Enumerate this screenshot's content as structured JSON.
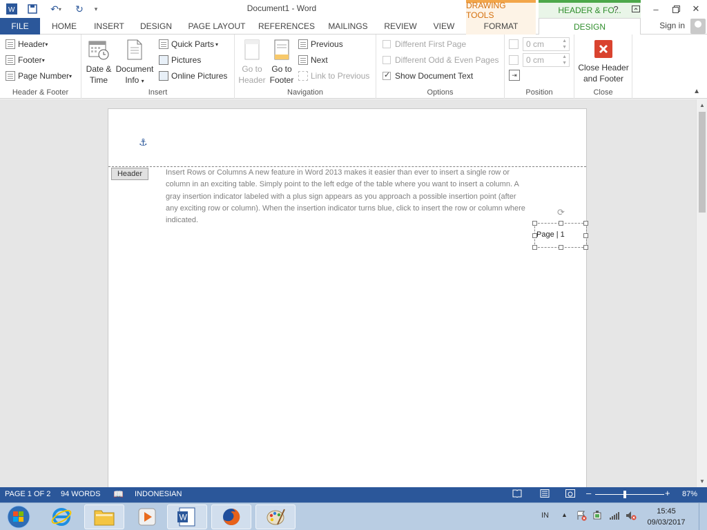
{
  "titlebar": {
    "title": "Document1 - Word",
    "context_drawing_tools": "DRAWING TOOLS",
    "context_header_footer": "HEADER & FO...",
    "help": "?",
    "colors": {
      "word_blue": "#2b579a",
      "drawing_tools": "#d5700d",
      "header_footer": "#2e8d2b"
    }
  },
  "tabs": {
    "file": "FILE",
    "home": "HOME",
    "insert": "INSERT",
    "design": "DESIGN",
    "page_layout": "PAGE LAYOUT",
    "references": "REFERENCES",
    "mailings": "MAILINGS",
    "review": "REVIEW",
    "view": "VIEW",
    "format": "FORMAT",
    "design_hf": "DESIGN",
    "sign_in": "Sign in"
  },
  "ribbon": {
    "header_footer": {
      "label": "Header & Footer",
      "header": "Header",
      "footer": "Footer",
      "page_number": "Page Number"
    },
    "insert": {
      "label": "Insert",
      "date_time_1": "Date &",
      "date_time_2": "Time",
      "doc_info_1": "Document",
      "doc_info_2": "Info",
      "quick_parts": "Quick Parts",
      "pictures": "Pictures",
      "online_pictures": "Online Pictures"
    },
    "navigation": {
      "label": "Navigation",
      "go_header_1": "Go to",
      "go_header_2": "Header",
      "go_footer_1": "Go to",
      "go_footer_2": "Footer",
      "previous": "Previous",
      "next": "Next",
      "link_previous": "Link to Previous"
    },
    "options": {
      "label": "Options",
      "different_first_page": "Different First Page",
      "different_odd_even": "Different Odd & Even Pages",
      "show_document_text": "Show Document Text",
      "show_document_text_checked": true
    },
    "position": {
      "label": "Position",
      "header_from_top": "0 cm",
      "footer_from_bottom": "0 cm"
    },
    "close": {
      "label": "Close",
      "close_hf_1": "Close Header",
      "close_hf_2": "and Footer"
    }
  },
  "document": {
    "header_tag": "Header",
    "body_text": "Insert Rows or Columns A new feature in Word 2013 makes it easier than ever to insert a single row or column in an exciting table. Simply point to the left edge of the table where you want to insert a column. A gray insertion indicator labeled with a plus sign appears as you approach a possible insertion point (after any exciting row or column). When the insertion indicator turns blue, click to insert the row or column where indicated.",
    "textbox_text": "Page | 1"
  },
  "statusbar": {
    "page": "PAGE 1 OF 2",
    "words": "94 WORDS",
    "language": "INDONESIAN",
    "zoom": "87%",
    "zoom_level_percent": 87
  },
  "taskbar": {
    "input_lang": "IN",
    "time": "15:45",
    "date": "09/03/2017"
  }
}
